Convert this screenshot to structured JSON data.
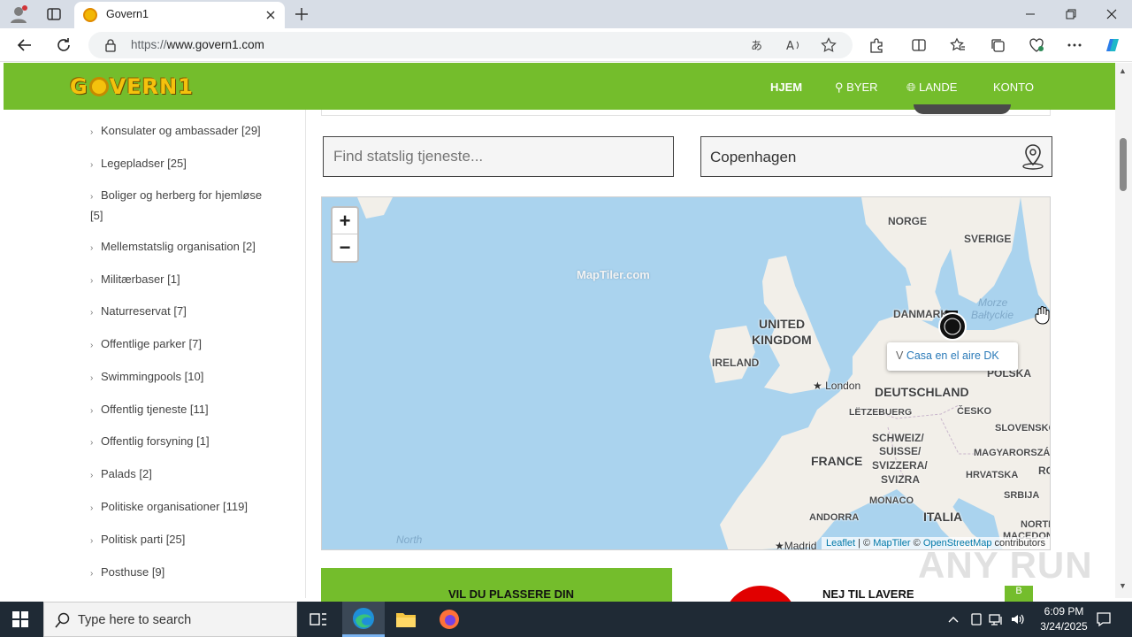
{
  "browser": {
    "tab_title": "Govern1",
    "url_scheme": "https://",
    "url_host": "www.govern1.com"
  },
  "site": {
    "logo_left": "G",
    "logo_right": "VERN1",
    "nav": {
      "home": "HJEM",
      "cities": "BYER",
      "countries": "LANDE",
      "account": "KONTO"
    },
    "categories": [
      "Konsulater og ambassader [29]",
      "Legepladser [25]",
      "Boliger og herberg for hjemløse [5]",
      "Mellemstatslig organisation [2]",
      "Militærbaser [1]",
      "Naturreservat [7]",
      "Offentlige parker [7]",
      "Swimmingpools [10]",
      "Offentlig tjeneste [11]",
      "Offentlig forsyning [1]",
      "Palads [2]",
      "Politiske organisationer [119]",
      "Politisk parti [25]",
      "Posthuse [9]"
    ],
    "search_placeholder": "Find statslig tjeneste...",
    "location_value": "Copenhagen",
    "map": {
      "zoom_in": "+",
      "zoom_out": "−",
      "watermark": "MapTiler.com",
      "labels": {
        "norge": "NORGE",
        "sverige": "SVERIGE",
        "uk1": "UNITED",
        "uk2": "KINGDOM",
        "ireland": "IRELAND",
        "danmark": "DANMARK",
        "baltic1": "Morze",
        "baltic2": "Bałtyckie",
        "polska": "POLSKA",
        "london": "London",
        "deutschland": "DEUTSCHLAND",
        "letzebuerg": "LËTZEBUERG",
        "cesko": "ČESKO",
        "slovensko": "SLOVENSKO",
        "schweiz1": "SCHWEIZ/",
        "schweiz2": "SUISSE/",
        "schweiz3": "SVIZZERA/",
        "schweiz4": "SVIZRA",
        "france": "FRANCE",
        "magyar": "MAGYARORSZÁG",
        "hrvatska": "HRVATSKA",
        "ro": "RO",
        "srbija": "SRBIJA",
        "monaco": "MONACO",
        "italia": "ITALIA",
        "andorra": "ANDORRA",
        "north_sea": "North",
        "north_mac": "NORTH",
        "macedon": "MACEDON",
        "madrid": "Madrid"
      },
      "popup_text": "Casa en el aire DK",
      "popup_prefix": "V",
      "attribution": {
        "leaflet": "Leaflet",
        "sep1": " | © ",
        "maptiler": "MapTiler",
        "sep2": " © ",
        "osm": "OpenStreetMap",
        "contributors": " contributors"
      }
    },
    "promo_left": "VIL DU PLASSERE DIN",
    "promo_right": "NEJ TIL LAVERE",
    "promo_right_btn": "B"
  },
  "watermark": "ANY RUN",
  "taskbar": {
    "search_placeholder": "Type here to search",
    "time": "6:09 PM",
    "date": "3/24/2025"
  },
  "colors": {
    "brand_green": "#74bd2c",
    "logo_gold": "#f4c20d",
    "map_water": "#aad3ee",
    "map_land": "#f2efe9"
  }
}
